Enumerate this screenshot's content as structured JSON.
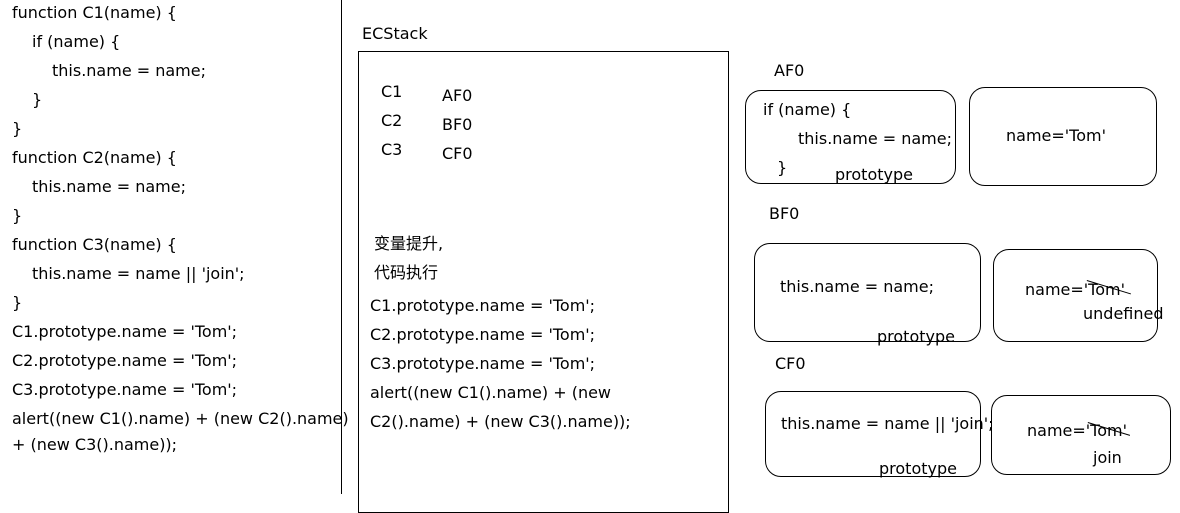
{
  "code": [
    "function C1(name) {",
    "if (name) {",
    "this.name = name;",
    "}",
    "}",
    "function C2(name) {",
    "this.name = name;",
    "}",
    "function C3(name) {",
    "this.name = name || 'join';",
    "}",
    "C1.prototype.name = 'Tom';",
    "C2.prototype.name = 'Tom';",
    "C3.prototype.name = 'Tom';",
    "alert((new C1().name) + (new C2().name)",
    "+ (new C3().name));"
  ],
  "ecstack": {
    "title": "ECStack",
    "rows": [
      {
        "fn": "C1",
        "ref": "AF0"
      },
      {
        "fn": "C2",
        "ref": "BF0"
      },
      {
        "fn": "C3",
        "ref": "CF0"
      }
    ],
    "lines": [
      "变量提升,",
      "代码执行",
      "C1.prototype.name = 'Tom';",
      "C2.prototype.name = 'Tom';",
      "C3.prototype.name = 'Tom';",
      "alert((new C1().name) + (new",
      "C2().name) + (new C3().name));"
    ]
  },
  "heaps": [
    {
      "label": "AF0",
      "code": [
        "if (name) {",
        "this.name = name;",
        "}"
      ],
      "prototype_label": "prototype",
      "proto_value": "name='Tom'"
    },
    {
      "label": "BF0",
      "code": [
        "this.name = name;"
      ],
      "prototype_label": "prototype",
      "proto_value": "name='Tom'",
      "note": "undefined"
    },
    {
      "label": "CF0",
      "code": [
        "this.name = name || 'join';"
      ],
      "prototype_label": "prototype",
      "proto_value": "name='Tom'",
      "note": "join"
    }
  ]
}
